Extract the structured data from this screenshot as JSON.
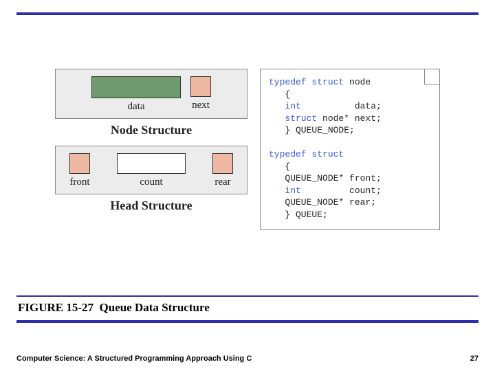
{
  "node_structure": {
    "data_label": "data",
    "next_label": "next",
    "title": "Node Structure"
  },
  "head_structure": {
    "front_label": "front",
    "count_label": "count",
    "rear_label": "rear",
    "title": "Head Structure"
  },
  "code": {
    "l1_kw": "typedef struct ",
    "l1_rest": "node",
    "l2": "   {",
    "l3_kw": "   int",
    "l3_rest": "          data;",
    "l4_kw": "   struct ",
    "l4_mid": "node* next;",
    "l5": "   } QUEUE_NODE;",
    "blank": "",
    "l6_kw": "typedef struct",
    "l7": "   {",
    "l8": "   QUEUE_NODE* front;",
    "l9_kw": "   int",
    "l9_rest": "         count;",
    "l10": "   QUEUE_NODE* rear;",
    "l11": "   } QUEUE;"
  },
  "caption": {
    "fignum": "FIGURE 15-27",
    "title": "Queue Data Structure"
  },
  "footer": {
    "book": "Computer Science: A Structured Programming Approach Using C",
    "page": "27"
  }
}
